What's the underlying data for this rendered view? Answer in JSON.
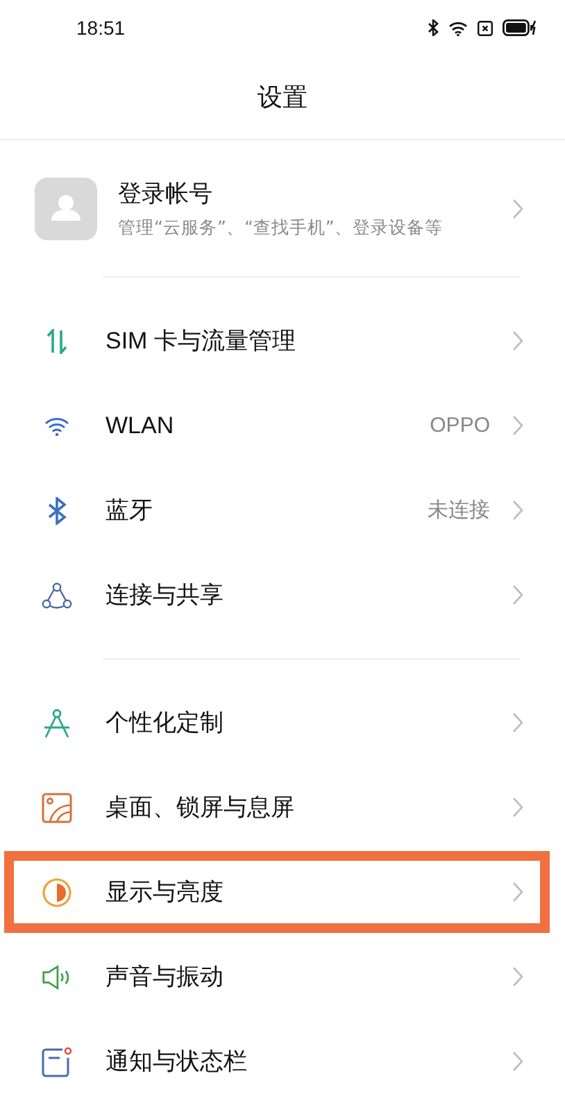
{
  "status_bar": {
    "time": "18:51"
  },
  "title": "设置",
  "account": {
    "title": "登录帐号",
    "subtitle": "管理“云服务”、“查找手机”、登录设备等"
  },
  "sections": [
    {
      "items": [
        {
          "label": "SIM 卡与流量管理",
          "highlighted": false
        },
        {
          "label": "WLAN",
          "value": "OPPO",
          "highlighted": false
        },
        {
          "label": "蓝牙",
          "value": "未连接",
          "highlighted": false
        },
        {
          "label": "连接与共享",
          "highlighted": false
        }
      ]
    },
    {
      "items": [
        {
          "label": "个性化定制",
          "highlighted": false
        },
        {
          "label": "桌面、锁屏与息屏",
          "highlighted": false
        },
        {
          "label": "显示与亮度",
          "highlighted": true
        },
        {
          "label": "声音与振动",
          "highlighted": false
        },
        {
          "label": "通知与状态栏",
          "highlighted": false
        }
      ]
    }
  ]
}
